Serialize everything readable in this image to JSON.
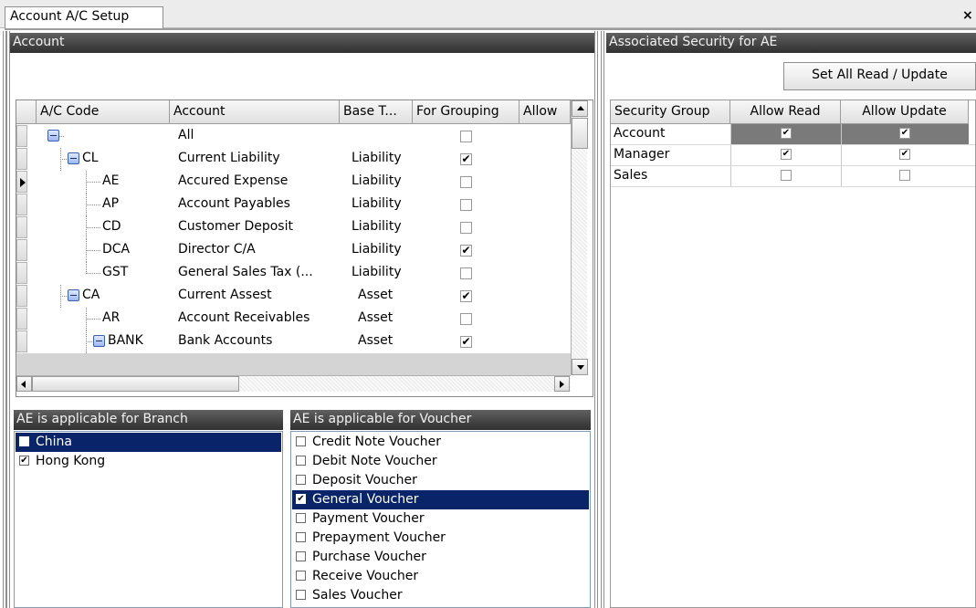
{
  "tab": {
    "title": "Account A/C Setup",
    "close": "×"
  },
  "account_panel": {
    "title": "Account",
    "columns": [
      "A/C Code",
      "Account",
      "Base T...",
      "For Grouping",
      "Allow"
    ],
    "rows": [
      {
        "code": "",
        "name": "All",
        "base": "",
        "grouping": false,
        "level": 0,
        "expander": true
      },
      {
        "code": "CL",
        "name": "Current Liability",
        "base": "Liability",
        "grouping": true,
        "level": 1,
        "expander": true
      },
      {
        "code": "AE",
        "name": "Accured Expense",
        "base": "Liability",
        "grouping": false,
        "level": 2,
        "expander": false,
        "current": true
      },
      {
        "code": "AP",
        "name": "Account Payables",
        "base": "Liability",
        "grouping": false,
        "level": 2,
        "expander": false
      },
      {
        "code": "CD",
        "name": "Customer Deposit",
        "base": "Liability",
        "grouping": false,
        "level": 2,
        "expander": false
      },
      {
        "code": "DCA",
        "name": "Director C/A",
        "base": "Liability",
        "grouping": true,
        "level": 2,
        "expander": false
      },
      {
        "code": "GST",
        "name": "General Sales Tax (...",
        "base": "Liability",
        "grouping": false,
        "level": 2,
        "expander": false
      },
      {
        "code": "CA",
        "name": "Current Assest",
        "base": "Asset",
        "grouping": true,
        "level": 1,
        "expander": true
      },
      {
        "code": "AR",
        "name": "Account Receivables",
        "base": "Asset",
        "grouping": false,
        "level": 2,
        "expander": false
      },
      {
        "code": "BANK",
        "name": "Bank Accounts",
        "base": "Asset",
        "grouping": true,
        "level": 2,
        "expander": true
      }
    ]
  },
  "branch_panel": {
    "title": "AE is applicable for Branch",
    "items": [
      {
        "label": "China",
        "checked": false,
        "selected": true
      },
      {
        "label": "Hong Kong",
        "checked": true,
        "selected": false
      }
    ]
  },
  "voucher_panel": {
    "title": "AE is applicable for Voucher",
    "items": [
      {
        "label": "Credit Note Voucher",
        "checked": false,
        "selected": false
      },
      {
        "label": "Debit Note Voucher",
        "checked": false,
        "selected": false
      },
      {
        "label": "Deposit Voucher",
        "checked": false,
        "selected": false
      },
      {
        "label": "General Voucher",
        "checked": true,
        "selected": true
      },
      {
        "label": "Payment Voucher",
        "checked": false,
        "selected": false
      },
      {
        "label": "Prepayment Voucher",
        "checked": false,
        "selected": false
      },
      {
        "label": "Purchase Voucher",
        "checked": false,
        "selected": false
      },
      {
        "label": "Receive Voucher",
        "checked": false,
        "selected": false
      },
      {
        "label": "Sales Voucher",
        "checked": false,
        "selected": false
      }
    ]
  },
  "security_panel": {
    "title": "Associated Security for AE",
    "set_all_label": "Set All Read / Update",
    "columns": [
      "Security Group",
      "Allow Read",
      "Allow Update"
    ],
    "rows": [
      {
        "group": "Account",
        "read": true,
        "update": true,
        "selected": true
      },
      {
        "group": "Manager",
        "read": true,
        "update": true,
        "selected": false
      },
      {
        "group": "Sales",
        "read": false,
        "update": false,
        "selected": false
      }
    ]
  },
  "colors": {
    "header_bar": "#404040",
    "selection": "#0a246a",
    "selected_row": "#7a7a7a"
  },
  "icons": {
    "checkmark": "✔",
    "expander": "minus-box-icon"
  }
}
